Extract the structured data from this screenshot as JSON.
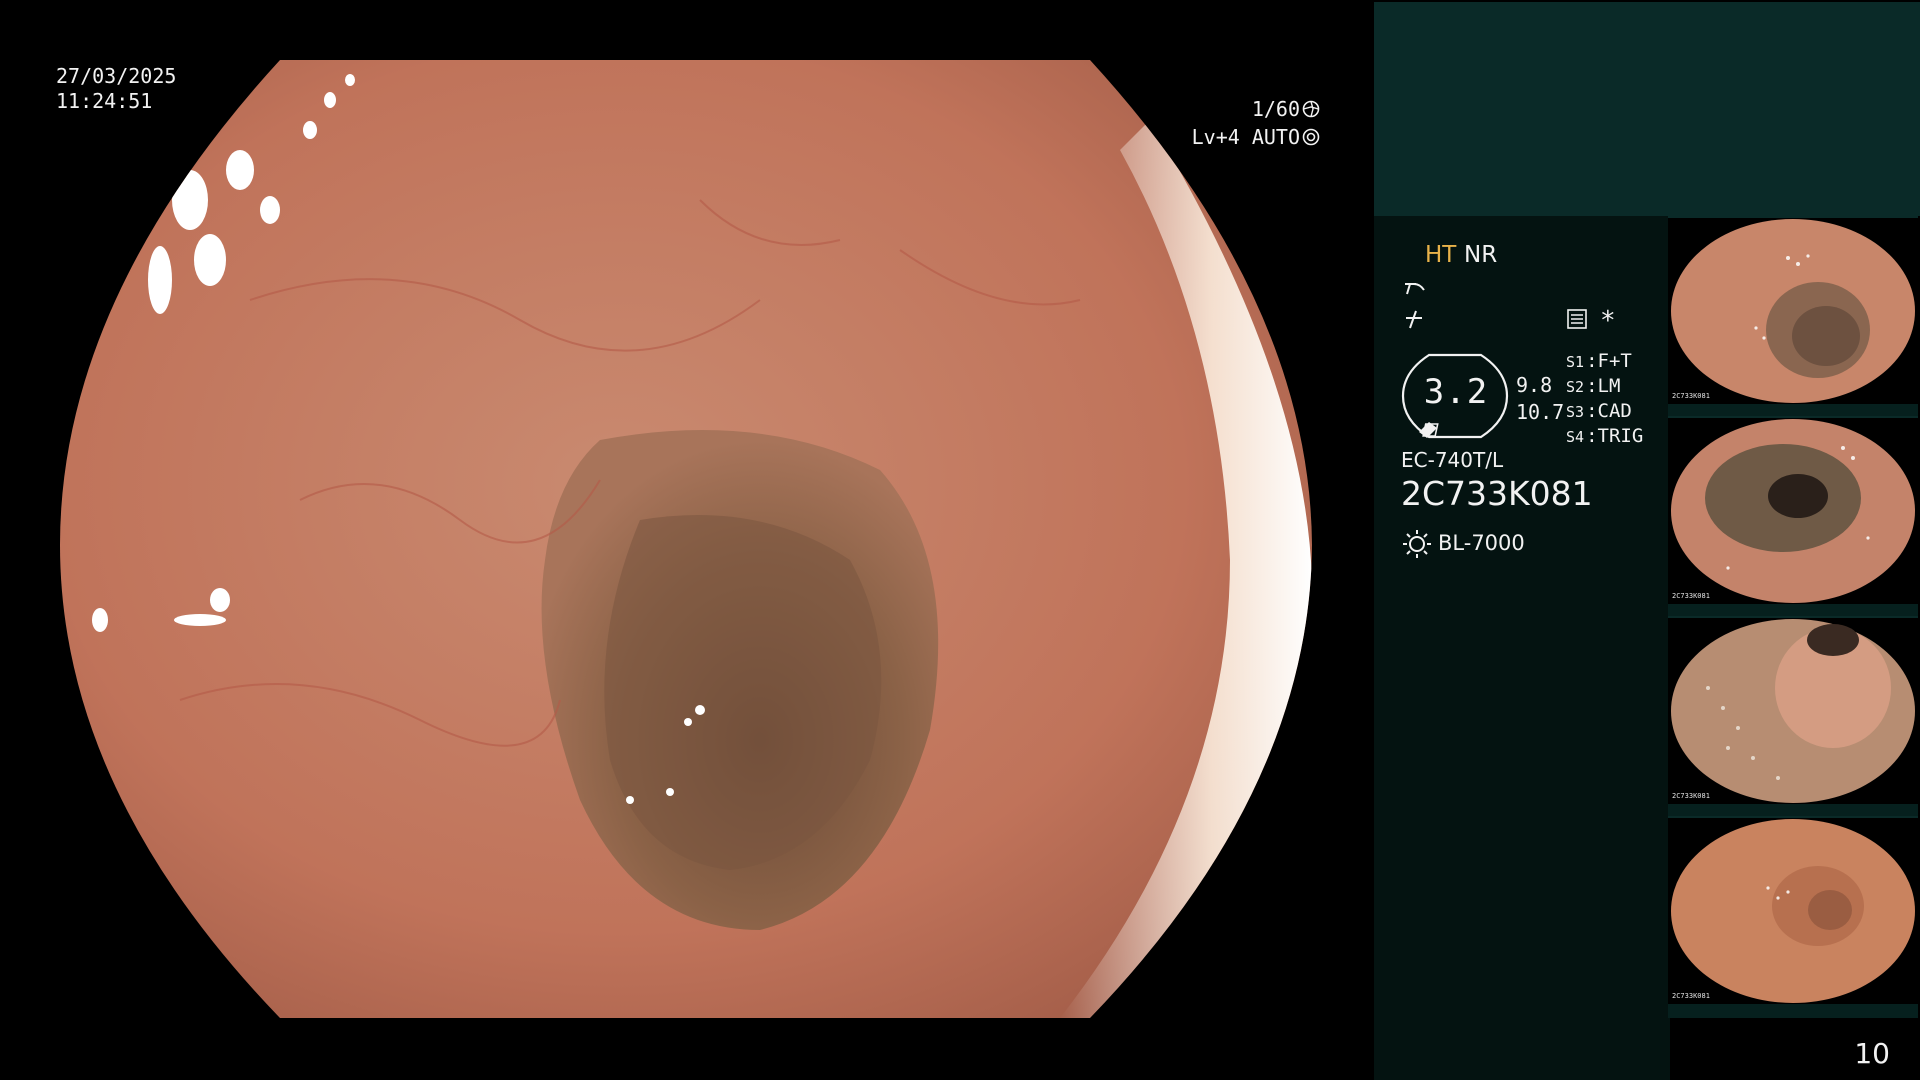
{
  "main_view": {
    "date": "27/03/2025",
    "time": "11:24:51",
    "shutter": "1/60",
    "shutter_icon": "shutter-icon",
    "level": "Lv+4 AUTO",
    "auto_icon": "iris-icon"
  },
  "panel": {
    "mode_ht": "HT",
    "mode_nr": "NR",
    "zoom": "3.2",
    "scale_1": "9.8",
    "scale_2": "10.7",
    "switches": [
      {
        "key": "S1",
        "sep": ":",
        "value": "F+T"
      },
      {
        "key": "S2",
        "sep": ":",
        "value": "LM"
      },
      {
        "key": "S3",
        "sep": ":",
        "value": "CAD"
      },
      {
        "key": "S4",
        "sep": ":",
        "value": "TRIG"
      }
    ],
    "asterisk": "*",
    "scope_model": "EC-740T/L",
    "scope_serial": "2C733K081",
    "light_source": "BL-7000",
    "image_count": "10",
    "colors": {
      "ht_accent": "#e8b24a",
      "panel_top": "#0a2a28",
      "panel_info": "#041311"
    }
  },
  "thumbnails": [
    {
      "label": "2C733K081"
    },
    {
      "label": "2C733K081"
    },
    {
      "label": "2C733K081"
    },
    {
      "label": "2C733K081"
    }
  ]
}
